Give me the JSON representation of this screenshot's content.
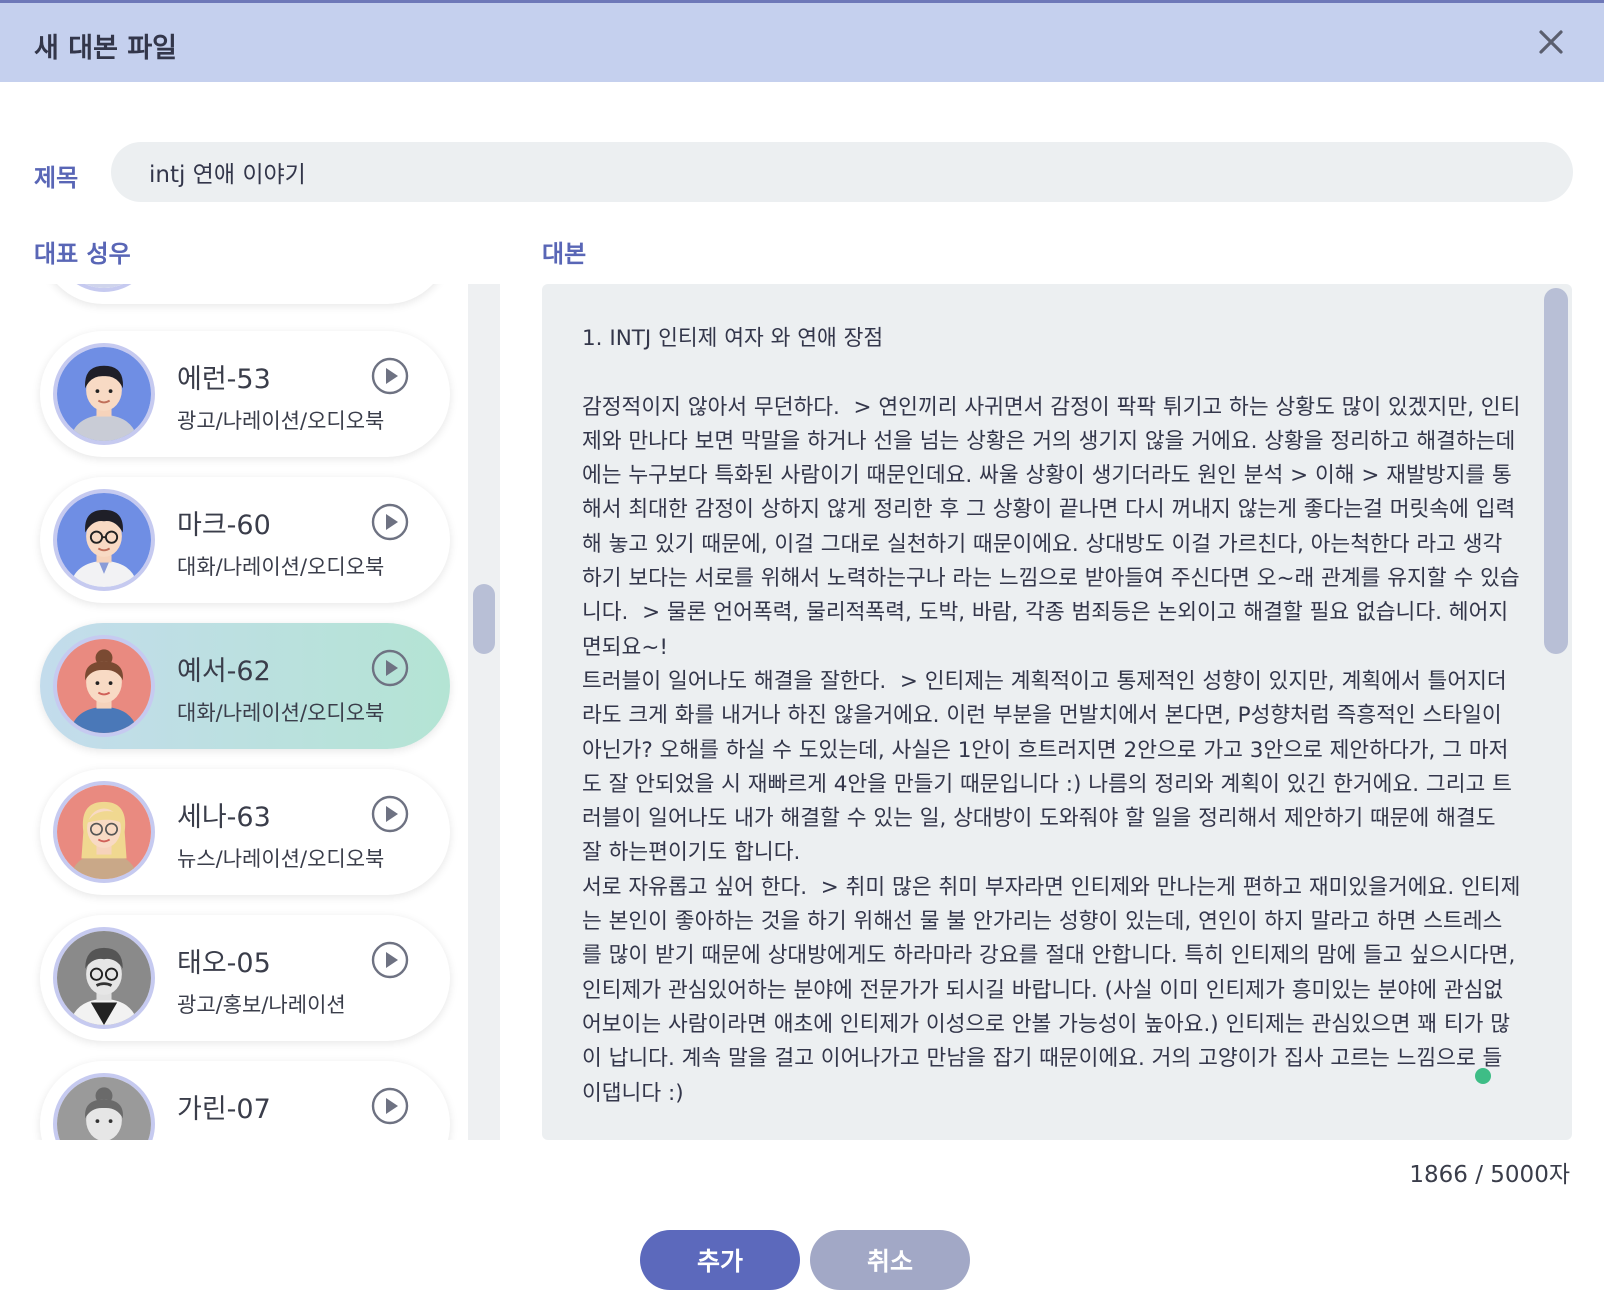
{
  "dialog": {
    "title": "새 대본 파일",
    "close_icon": "close-icon"
  },
  "title_field": {
    "label": "제목",
    "value": "intj 연애 이야기"
  },
  "voice_section": {
    "label": "대표 성우",
    "voices": [
      {
        "name": "에런-53",
        "tags": "광고/나레이션/오디오북",
        "selected": false
      },
      {
        "name": "마크-60",
        "tags": "대화/나레이션/오디오북",
        "selected": false
      },
      {
        "name": "예서-62",
        "tags": "대화/나레이션/오디오북",
        "selected": true
      },
      {
        "name": "세나-63",
        "tags": "뉴스/나레이션/오디오북",
        "selected": false
      },
      {
        "name": "태오-05",
        "tags": "광고/홍보/나레이션",
        "selected": false
      },
      {
        "name": "가린-07",
        "tags": "",
        "selected": false
      }
    ]
  },
  "script_section": {
    "label": "대본",
    "text": "1. INTJ 인티제 여자 와 연애 장점\n\n감정적이지 않아서 무던하다.  > 연인끼리 사귀면서 감정이 팍팍 튀기고 하는 상황도 많이 있겠지만, 인티제와 만나다 보면 막말을 하거나 선을 넘는 상황은 거의 생기지 않을 거에요. 상황을 정리하고 해결하는데에는 누구보다 특화된 사람이기 때문인데요. 싸울 상황이 생기더라도 원인 분석 > 이해 > 재발방지를 통해서 최대한 감정이 상하지 않게 정리한 후 그 상황이 끝나면 다시 꺼내지 않는게 좋다는걸 머릿속에 입력해 놓고 있기 때문에, 이걸 그대로 실천하기 때문이에요. 상대방도 이걸 가르친다, 아는척한다 라고 생각하기 보다는 서로를 위해서 노력하는구나 라는 느낌으로 받아들여 주신다면 오~래 관계를 유지할 수 있습니다.  > 물론 언어폭력, 물리적폭력, 도박, 바람, 각종 범죄등은 논외이고 해결할 필요 없습니다. 헤어지면되요~!\n트러블이 일어나도 해결을 잘한다.  > 인티제는 계획적이고 통제적인 성향이 있지만, 계획에서 틀어지더라도 크게 화를 내거나 하진 않을거에요. 이런 부분을 먼발치에서 본다면, P성향처럼 즉흥적인 스타일이 아닌가? 오해를 하실 수 도있는데, 사실은 1안이 흐트러지면 2안으로 가고 3안으로 제안하다가, 그 마저도 잘 안되었을 시 재빠르게 4안을 만들기 때문입니다 :) 나름의 정리와 계획이 있긴 한거에요. 그리고 트러블이 일어나도 내가 해결할 수 있는 일, 상대방이 도와줘야 할 일을 정리해서 제안하기 때문에 해결도 잘 하는편이기도 합니다.\n서로 자유롭고 싶어 한다.  > 취미 많은 취미 부자라면 인티제와 만나는게 편하고 재미있을거에요. 인티제는 본인이 좋아하는 것을 하기 위해선 물 불 안가리는 성향이 있는데, 연인이 하지 말라고 하면 스트레스를 많이 받기 때문에 상대방에게도 하라마라 강요를 절대 안합니다. 특히 인티제의 맘에 들고 싶으시다면, 인티제가 관심있어하는 분야에 전문가가 되시길 바랍니다. (사실 이미 인티제가 흥미있는 분야에 관심없어보이는 사람이라면 애초에 인티제가 이성으로 안볼 가능성이 높아요.) 인티제는 관심있으면 꽤 티가 많이 납니다. 계속 말을 걸고 이어나가고 만남을 잡기 때문이에요. 거의 고양이가 집사 고르는 느낌으로 들이댑니다 :)"
  },
  "counter": "1866 / 5000자",
  "buttons": {
    "add": "추가",
    "cancel": "취소"
  },
  "colors": {
    "accent": "#5c69bc",
    "header_bg": "#c5d0ee",
    "selected_from": "#c3dcec",
    "selected_to": "#b4e4d4"
  }
}
